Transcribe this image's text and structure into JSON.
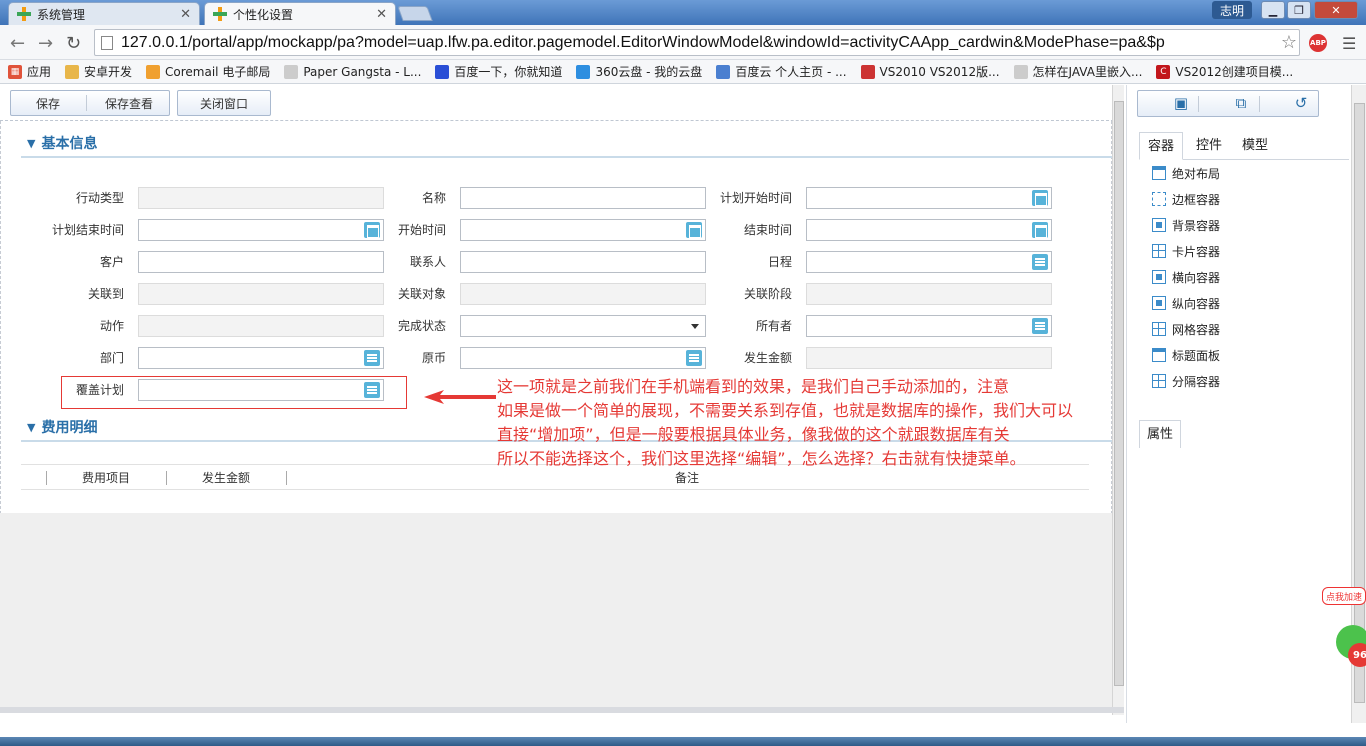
{
  "browser": {
    "tabs": [
      {
        "label": "系统管理",
        "active": false
      },
      {
        "label": "个性化设置",
        "active": true
      }
    ],
    "user": "志明",
    "url": "127.0.0.1/portal/app/mockapp/pa?model=uap.lfw.pa.editor.pagemodel.EditorWindowModel&windowId=activityCAApp_cardwin&ModePhase=pa&$p",
    "abp_label": "ABP",
    "bookmarks": [
      {
        "label": "应用",
        "icon": "apps-icon"
      },
      {
        "label": "安卓开发",
        "icon": "folder-icon"
      },
      {
        "label": "Coremail 电子邮局",
        "icon": "coremail-icon"
      },
      {
        "label": "Paper Gangsta - L...",
        "icon": "page-icon"
      },
      {
        "label": "百度一下，你就知道",
        "icon": "baidu-icon"
      },
      {
        "label": "360云盘 - 我的云盘",
        "icon": "cloud-icon"
      },
      {
        "label": "百度云 个人主页 - ...",
        "icon": "baiduyun-icon"
      },
      {
        "label": "VS2010 VS2012版...",
        "icon": "vs-icon"
      },
      {
        "label": "怎样在JAVA里嵌入...",
        "icon": "page-icon"
      },
      {
        "label": "VS2012创建项目模...",
        "icon": "csdn-icon"
      }
    ]
  },
  "toolbar": {
    "save": "保存",
    "save_view": "保存查看",
    "close": "关闭窗口"
  },
  "sections": {
    "basic": "基本信息",
    "expense": "费用明细"
  },
  "form": {
    "r1": {
      "l1": "行动类型",
      "l2": "名称",
      "l3": "计划开始时间"
    },
    "r2": {
      "l1": "计划结束时间",
      "l2": "开始时间",
      "l3": "结束时间"
    },
    "r3": {
      "l1": "客户",
      "l2": "联系人",
      "l3": "日程"
    },
    "r4": {
      "l1": "关联到",
      "l2": "关联对象",
      "l3": "关联阶段"
    },
    "r5": {
      "l1": "动作",
      "l2": "完成状态",
      "l3": "所有者"
    },
    "r6": {
      "l1": "部门",
      "l2": "原币",
      "l3": "发生金额"
    },
    "r7": {
      "l1": "覆盖计划"
    }
  },
  "annotation": {
    "line1": "这一项就是之前我们在手机端看到的效果，是我们自己手动添加的，注意",
    "line2": "如果是做一个简单的展现，不需要关系到存值，也就是数据库的操作，我们大可以",
    "line3": "直接“增加项”，但是一般要根据具体业务，像我做的这个就跟数据库有关",
    "line4": "所以不能选择这个，我们这里选择“编辑”，怎么选择？右击就有快捷菜单。",
    "color": "#e53935"
  },
  "grid": {
    "columns": [
      "费用项目",
      "发生金额",
      "备注"
    ]
  },
  "right_panel": {
    "tabs": [
      "容器",
      "控件",
      "模型"
    ],
    "items": [
      "绝对布局",
      "边框容器",
      "背景容器",
      "卡片容器",
      "横向容器",
      "纵向容器",
      "网格容器",
      "标题面板",
      "分隔容器"
    ],
    "props_tab": "属性"
  },
  "widget": {
    "tag": "点我加速",
    "badge": "96"
  },
  "colors": {
    "accent": "#2a6fa8",
    "field_icon": "#57b3d9"
  }
}
